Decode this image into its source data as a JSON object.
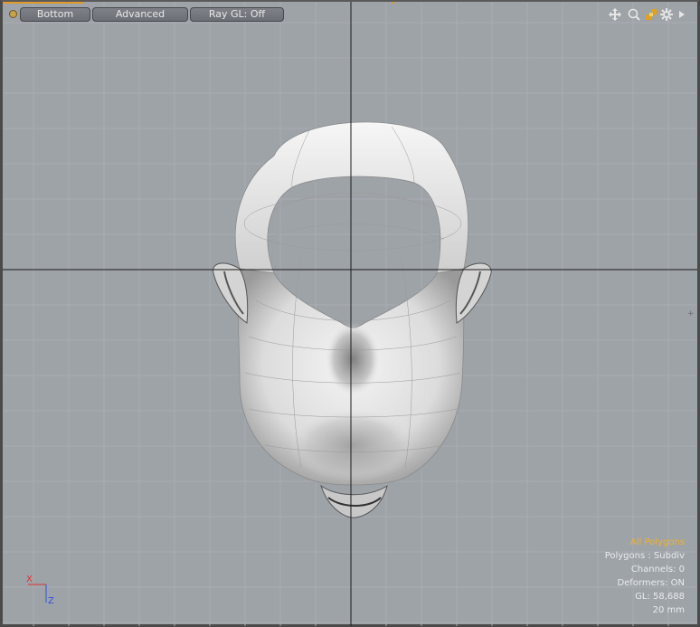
{
  "viewport": {
    "view_label": "Bottom",
    "shading_label": "Advanced",
    "raygl_label": "Ray GL: Off",
    "icons": [
      "move-view-icon",
      "zoom-view-icon",
      "rotate-view-icon",
      "settings-icon",
      "expand-arrow-icon"
    ]
  },
  "info": {
    "selection": "All Polygons",
    "polygons": "Polygons : Subdiv",
    "channels": "Channels: 0",
    "deformers": "Deformers: ON",
    "gl": "GL: 58,688",
    "grid": "20 mm"
  },
  "axis": {
    "x": "X",
    "z": "Z",
    "x_color": "#e03030",
    "z_color": "#3050e0"
  },
  "colors": {
    "accent": "#e09a2a",
    "background": "#9ea3a8",
    "selection_text": "#f0b030"
  }
}
